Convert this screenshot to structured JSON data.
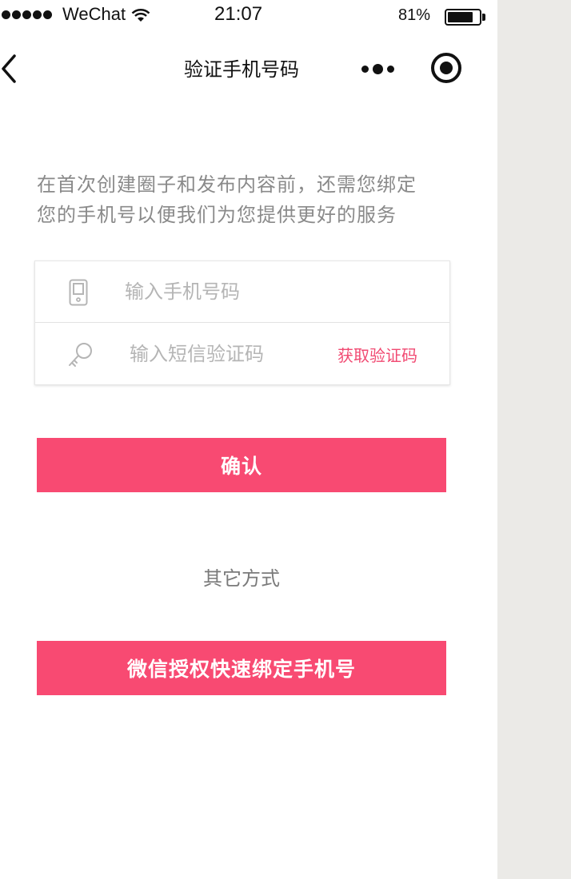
{
  "status_bar": {
    "carrier": "WeChat",
    "time": "21:07",
    "battery_percent": "81%",
    "battery_level": 0.81,
    "icons": [
      "signal-dots-icon",
      "wifi-icon",
      "battery-icon"
    ]
  },
  "nav": {
    "title": "验证手机号码",
    "icons": [
      "back-chevron-icon",
      "more-dots-icon",
      "close-circle-icon"
    ]
  },
  "intro": {
    "line1": "在首次创建圈子和发布内容前，还需您绑定",
    "line2": "您的手机号以便我们为您提供更好的服务"
  },
  "form": {
    "phone_placeholder": "输入手机号码",
    "phone_value": "",
    "code_placeholder": "输入短信验证码",
    "code_value": "",
    "get_code_label": "获取验证码",
    "icons": [
      "phone-icon",
      "key-icon"
    ]
  },
  "actions": {
    "confirm_label": "确认",
    "other_methods_label": "其它方式",
    "wechat_bind_label": "微信授权快速绑定手机号"
  },
  "colors": {
    "accent": "#f84a72",
    "link": "#f14a72",
    "side_background": "#ebeae7",
    "text_muted": "#8a8a8a"
  }
}
